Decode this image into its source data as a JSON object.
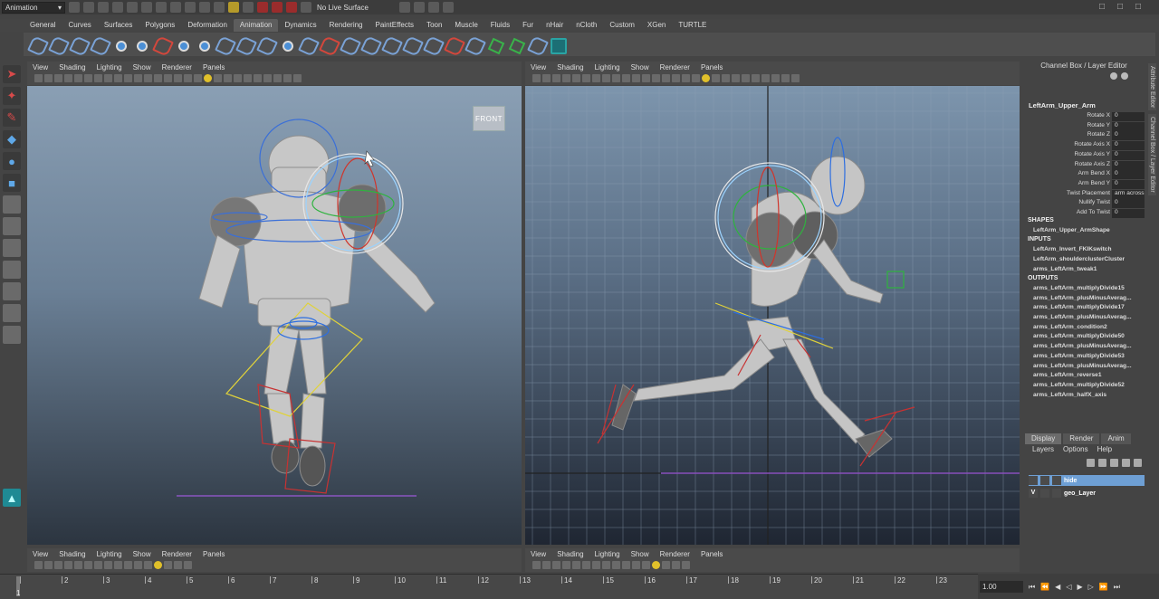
{
  "app": {
    "mode": "Animation",
    "live_surface": "No Live Surface"
  },
  "shelf_tabs": [
    "General",
    "Curves",
    "Surfaces",
    "Polygons",
    "Deformation",
    "Animation",
    "Dynamics",
    "Rendering",
    "PaintEffects",
    "Toon",
    "Muscle",
    "Fluids",
    "Fur",
    "nHair",
    "nCloth",
    "Custom",
    "XGen",
    "TURTLE"
  ],
  "shelf_active": "Animation",
  "panel_menu": [
    "View",
    "Shading",
    "Lighting",
    "Show",
    "Renderer",
    "Panels"
  ],
  "viewport_left": {
    "label": "FRONT"
  },
  "channel_box": {
    "title": "Channel Box / Layer Editor",
    "node": "LeftArm_Upper_Arm",
    "attributes": [
      {
        "name": "Rotate X",
        "value": "0"
      },
      {
        "name": "Rotate Y",
        "value": "0"
      },
      {
        "name": "Rotate Z",
        "value": "0"
      },
      {
        "name": "Rotate Axis X",
        "value": "0"
      },
      {
        "name": "Rotate Axis Y",
        "value": "0"
      },
      {
        "name": "Rotate Axis Z",
        "value": "0"
      },
      {
        "name": "Arm Bend X",
        "value": "0"
      },
      {
        "name": "Arm Bend Y",
        "value": "0"
      },
      {
        "name": "Twist Placement",
        "value": "arm across"
      },
      {
        "name": "Nullify Twist",
        "value": "0"
      },
      {
        "name": "Add To Twist",
        "value": "0"
      }
    ],
    "shapes_label": "SHAPES",
    "shapes": [
      "LeftArm_Upper_ArmShape"
    ],
    "inputs_label": "INPUTS",
    "inputs": [
      "LeftArm_Invert_FKIKswitch",
      "LeftArm_shoulderclusterCluster",
      "arms_LeftArm_tweak1"
    ],
    "outputs_label": "OUTPUTS",
    "outputs": [
      "arms_LeftArm_multiplyDivide15",
      "arms_LeftArm_plusMinusAverag...",
      "arms_LeftArm_multiplyDivide17",
      "arms_LeftArm_plusMinusAverag...",
      "arms_LeftArm_condition2",
      "arms_LeftArm_multiplyDivide50",
      "arms_LeftArm_plusMinusAverag...",
      "arms_LeftArm_multiplyDivide53",
      "arms_LeftArm_plusMinusAverag...",
      "arms_LeftArm_reverse1",
      "arms_LeftArm_multiplyDivide52",
      "arms_LeftArm_halfX_axis"
    ]
  },
  "side_tabs": [
    "Attribute Editor",
    "Channel Box / Layer Editor"
  ],
  "layer_editor": {
    "tabs": [
      "Display",
      "Render",
      "Anim"
    ],
    "active_tab": "Display",
    "menu": [
      "Layers",
      "Options",
      "Help"
    ],
    "layers": [
      {
        "visible": "",
        "name": "hide",
        "selected": true
      },
      {
        "visible": "V",
        "name": "geo_Layer",
        "selected": false
      }
    ]
  },
  "timeline": {
    "ticks": [
      "1",
      "2",
      "3",
      "4",
      "5",
      "6",
      "7",
      "8",
      "9",
      "10",
      "11",
      "12",
      "13",
      "14",
      "15",
      "16",
      "17",
      "18",
      "19",
      "20",
      "21",
      "22",
      "23"
    ],
    "current_frame": "1",
    "frame_field": "1.00"
  }
}
